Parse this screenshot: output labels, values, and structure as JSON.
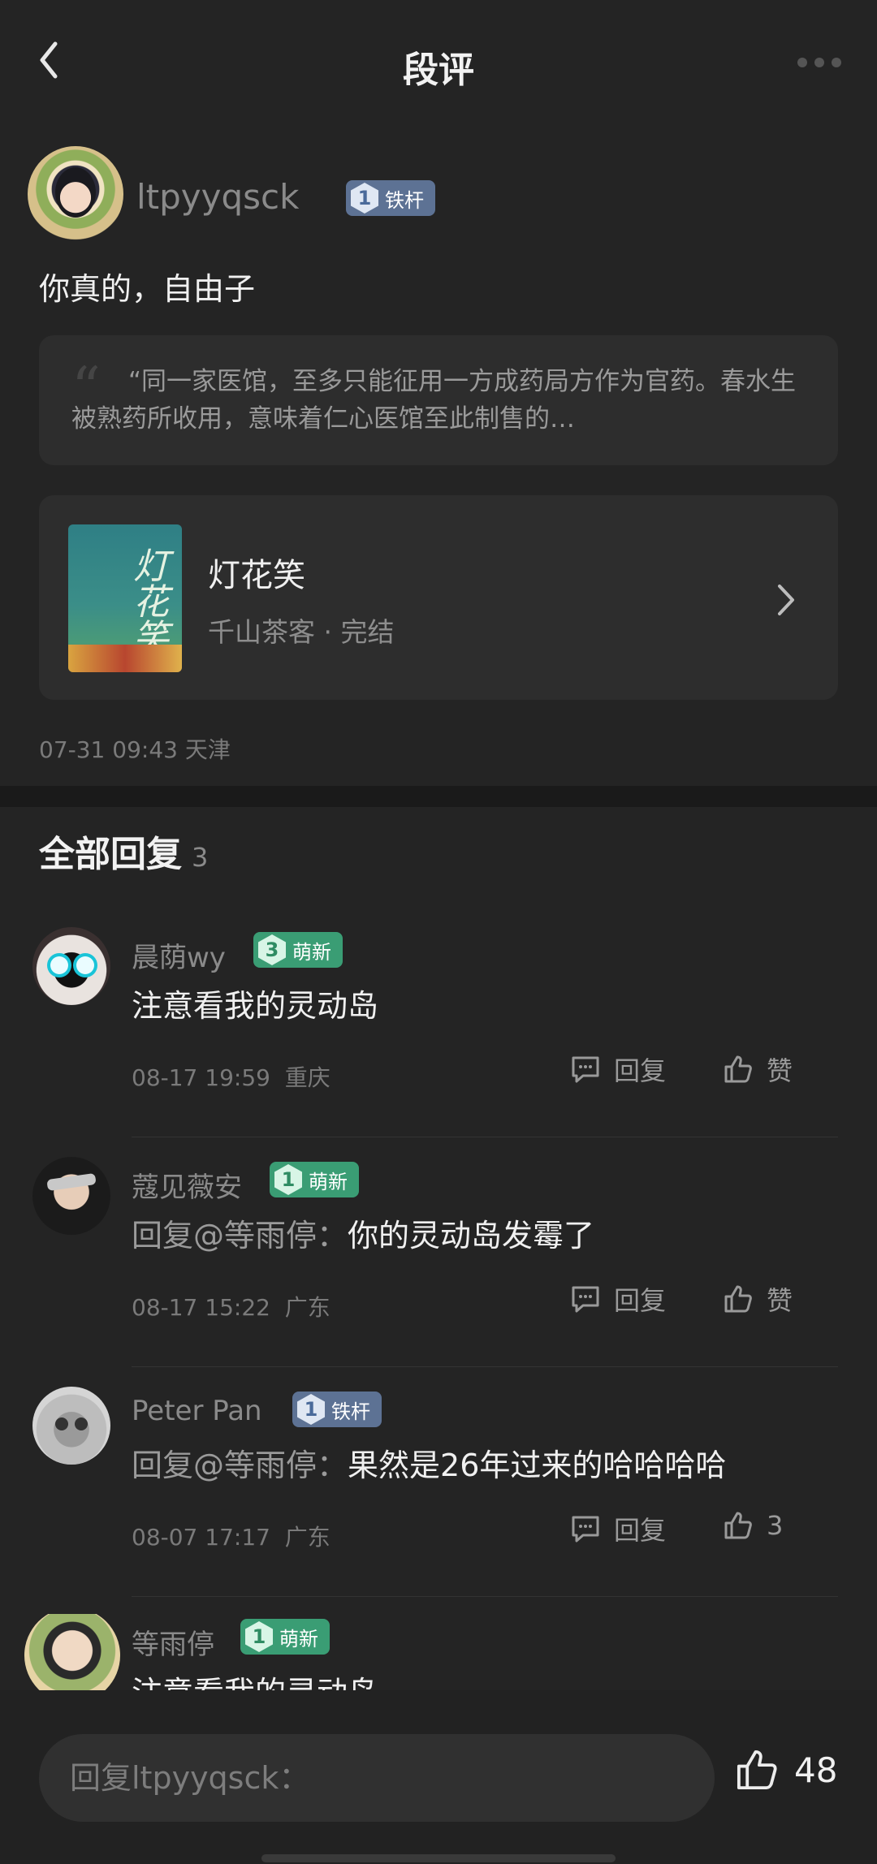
{
  "header": {
    "title": "段评",
    "back_icon": "chevron-left-icon",
    "more_icon": "more-dots-icon"
  },
  "post": {
    "author": "ltpyyqsck",
    "badge_level": "1",
    "badge_label": "铁杆",
    "text": "你真的，自由子",
    "quote": "“同一家医馆，至多只能征用一方成药局方作为官药。春水生被熟药所收用，意味着仁心医馆至此制售的…",
    "book": {
      "title": "灯花笑",
      "meta": "千山茶客 · 完结"
    },
    "time": "07-31 09:43",
    "location": "天津"
  },
  "replies_section": {
    "title": "全部回复",
    "count": "3"
  },
  "replies": [
    {
      "name": "晨荫wy",
      "badge_level": "3",
      "badge_label": "萌新",
      "badge_type": "new",
      "prefix": "",
      "text": "注意看我的灵动岛",
      "time": "08-17 19:59",
      "location": "重庆",
      "reply_label": "回复",
      "like_label": "赞"
    },
    {
      "name": "蔻见薇安",
      "badge_level": "1",
      "badge_label": "萌新",
      "badge_type": "new",
      "prefix": "回复@等雨停：",
      "text": "你的灵动岛发霉了",
      "time": "08-17 15:22",
      "location": "广东",
      "reply_label": "回复",
      "like_label": "赞"
    },
    {
      "name": "Peter Pan",
      "badge_level": "1",
      "badge_label": "铁杆",
      "badge_type": "iron",
      "prefix": "回复@等雨停：",
      "text": "果然是26年过来的哈哈哈哈",
      "time": "08-07 17:17",
      "location": "广东",
      "reply_label": "回复",
      "like_label": "3"
    },
    {
      "name": "等雨停",
      "badge_level": "1",
      "badge_label": "萌新",
      "badge_type": "new",
      "prefix": "",
      "text": "注意看我的灵动岛"
    }
  ],
  "bottom_bar": {
    "placeholder": "回复ltpyyqsck：",
    "like_count": "48"
  },
  "colors": {
    "background": "#242424",
    "badge_iron": "#5d7294",
    "badge_new": "#3a9d74"
  }
}
